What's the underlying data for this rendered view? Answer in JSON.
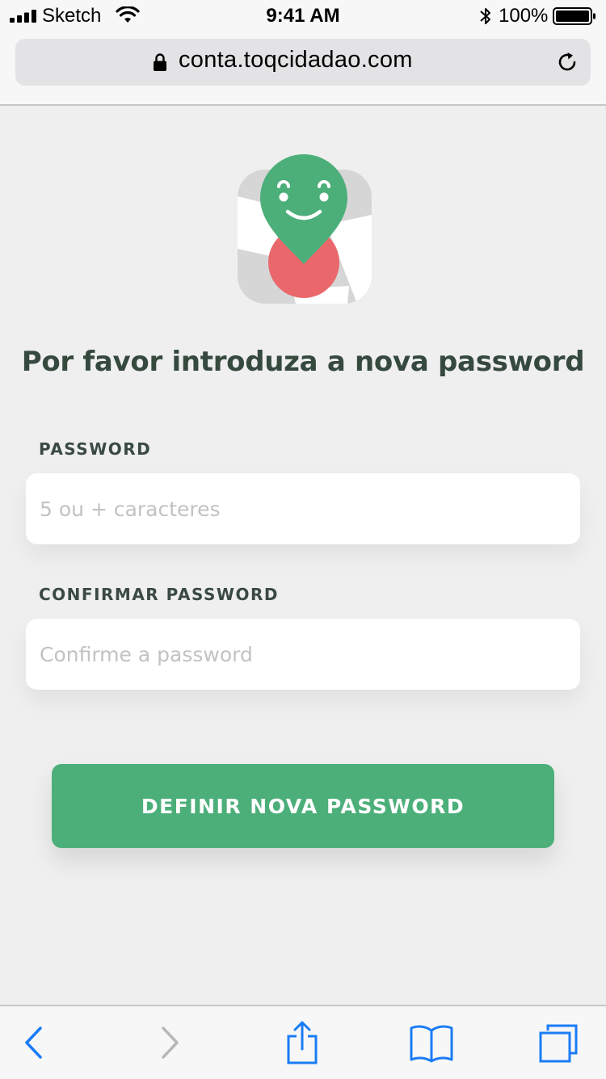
{
  "status_bar": {
    "carrier": "Sketch",
    "time": "9:41 AM",
    "battery_percent": "100%"
  },
  "browser": {
    "url": "conta.toqcidadao.com"
  },
  "page": {
    "heading": "Por favor introduza a nova password",
    "password_label": "PASSWORD",
    "password_placeholder": "5 ou + caracteres",
    "confirm_label": "CONFIRMAR PASSWORD",
    "confirm_placeholder": "Confirme a password",
    "submit_label": "DEFINIR NOVA PASSWORD"
  },
  "colors": {
    "accent_green": "#4caf7a",
    "heading_text": "#36493f",
    "ios_blue": "#1a7cf5",
    "logo_red": "#ea686b"
  },
  "toolbar": {
    "icons": [
      "back-icon",
      "forward-icon",
      "share-icon",
      "bookmarks-icon",
      "tabs-icon"
    ]
  }
}
